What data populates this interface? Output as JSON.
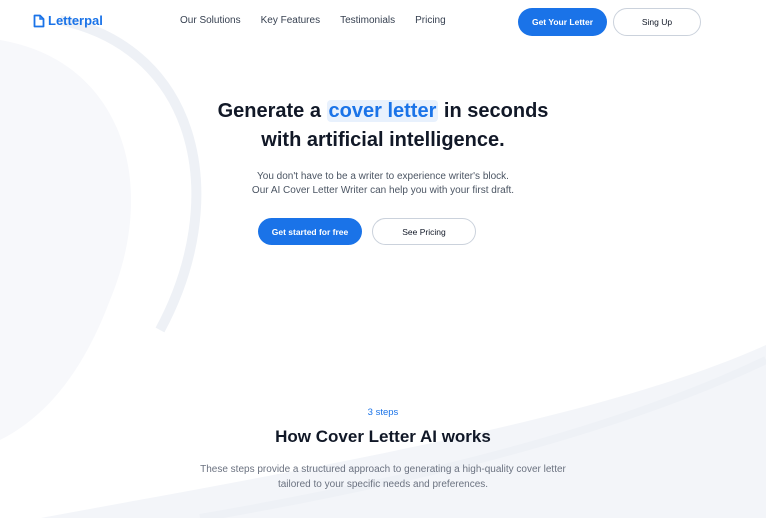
{
  "nav": {
    "brand": "Letterpal",
    "links": [
      "Our Solutions",
      "Key Features",
      "Testimonials",
      "Pricing"
    ],
    "cta_label": "Get Your Letter",
    "signup_label": "Sing Up"
  },
  "hero": {
    "title_prefix": "Generate a ",
    "title_highlight": "cover letter",
    "title_suffix": " in seconds",
    "title_line2": "with artificial intelligence.",
    "subtitle_line1": "You don't have to be a writer to experience writer's block.",
    "subtitle_line2": "Our AI Cover Letter Writer can help you with your first draft.",
    "primary_button": "Get started for free",
    "secondary_button": "See Pricing"
  },
  "steps": {
    "label": "3 steps",
    "title": "How Cover Letter AI works",
    "desc_line1": "These steps provide a structured approach to generating a high-quality cover letter",
    "desc_line2": "tailored to your specific needs and preferences."
  },
  "colors": {
    "accent": "#1a73e8",
    "highlight_bg": "#e8f1fd",
    "text_dark": "#111827",
    "text_muted": "#6b7280"
  }
}
